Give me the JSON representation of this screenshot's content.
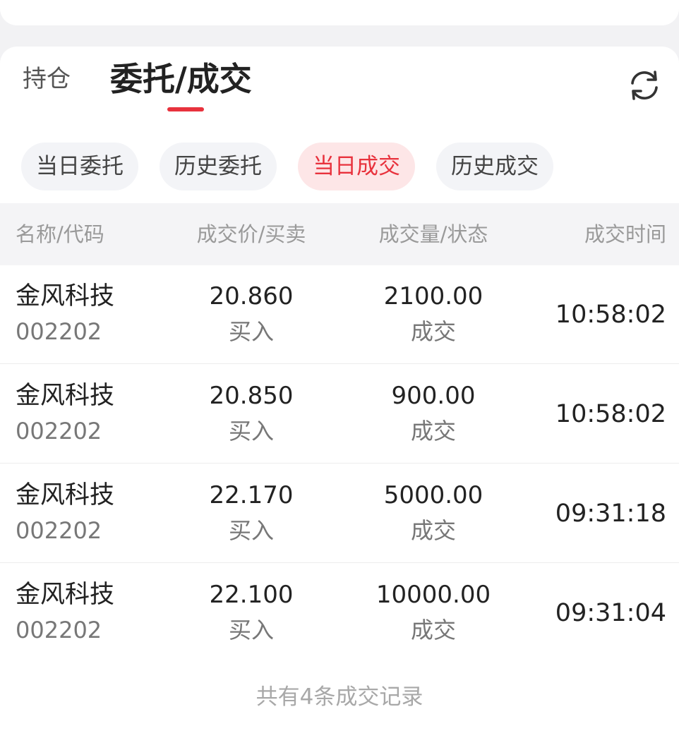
{
  "tabs": {
    "holdings_label": "持仓",
    "orders_label": "委托/成交"
  },
  "accent_color": "#e8323d",
  "refresh_icon": "refresh-icon",
  "filter_chips": [
    {
      "label": "当日委托",
      "active": false
    },
    {
      "label": "历史委托",
      "active": false
    },
    {
      "label": "当日成交",
      "active": true
    },
    {
      "label": "历史成交",
      "active": false
    }
  ],
  "table": {
    "headers": [
      "名称/代码",
      "成交价/买卖",
      "成交量/状态",
      "成交时间"
    ],
    "rows": [
      {
        "name": "金风科技",
        "code": "002202",
        "price": "20.860",
        "side": "买入",
        "volume": "2100.00",
        "status": "成交",
        "time": "10:58:02"
      },
      {
        "name": "金风科技",
        "code": "002202",
        "price": "20.850",
        "side": "买入",
        "volume": "900.00",
        "status": "成交",
        "time": "10:58:02"
      },
      {
        "name": "金风科技",
        "code": "002202",
        "price": "22.170",
        "side": "买入",
        "volume": "5000.00",
        "status": "成交",
        "time": "09:31:18"
      },
      {
        "name": "金风科技",
        "code": "002202",
        "price": "22.100",
        "side": "买入",
        "volume": "10000.00",
        "status": "成交",
        "time": "09:31:04"
      }
    ]
  },
  "footer_text": "共有4条成交记录"
}
